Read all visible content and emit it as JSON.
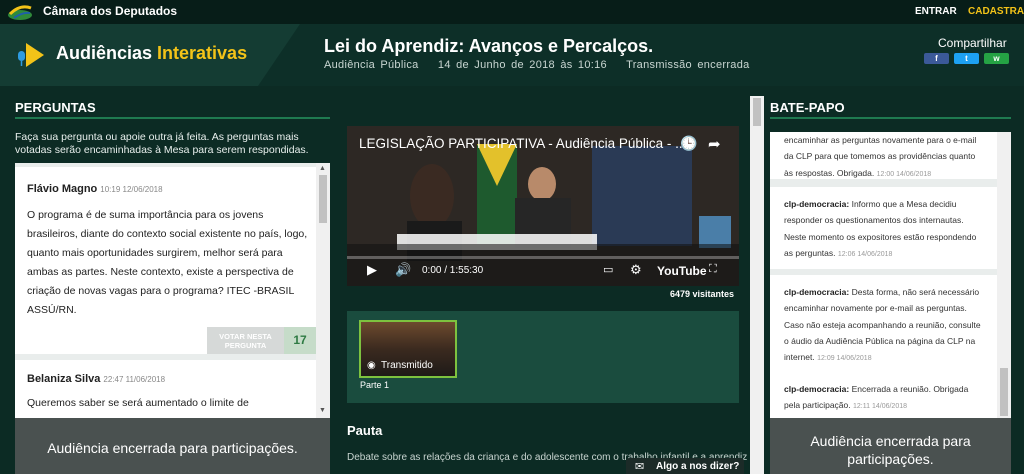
{
  "topbar": {
    "org_name": "Câmara dos Deputados",
    "login": "ENTRAR",
    "register": "CADASTRAR"
  },
  "header": {
    "brand_main": "Audiências ",
    "brand_accent": "Interativas",
    "title": "Lei do Aprendiz: Avanços e Percalços.",
    "type": "Audiência Pública",
    "datetime": "14 de Junho de 2018 às 10:16",
    "status": "Transmissão encerrada",
    "share_label": "Compartilhar",
    "share": {
      "facebook": "f",
      "twitter": "t",
      "whatsapp": "w"
    }
  },
  "perguntas": {
    "heading": "PERGUNTAS",
    "intro": "Faça sua pergunta ou apoie outra já feita. As perguntas mais votadas serão encaminhadas à Mesa para serem respondidas.",
    "questions": [
      {
        "author": "Flávio Magno",
        "time": "10:19 12/06/2018",
        "text": "O programa é de suma importância para os jovens brasileiros, diante do contexto social existente no país, logo, quanto mais oportunidades surgirem, melhor será para ambas as partes. Neste contexto, existe a perspectiva de criação de novas vagas para o programa? ITEC -BRASIL ASSÚ/RN.",
        "vote_label": "VOTAR NESTA PERGUNTA",
        "votes": "17"
      },
      {
        "author": "Belaniza Silva",
        "time": "22:47 11/06/2018",
        "text": "Queremos saber se será aumentado o limite de"
      }
    ],
    "closed": "Audiência encerrada para participações."
  },
  "video": {
    "title": "LEGISLAÇÃO PARTICIPATIVA - Audiência Pública - ...",
    "time": "0:00 / 1:55:30",
    "youtube": "YouTube",
    "visitors": "6479 visitantes"
  },
  "parts": {
    "badge": "Transmitido",
    "label": "Parte 1"
  },
  "pauta": {
    "heading": "Pauta",
    "text": "Debate sobre as relações da criança e do adolescente com o trabalho infantil e a aprendizagem."
  },
  "feedback": {
    "label": "Algo a nos dizer?"
  },
  "chat": {
    "heading": "BATE-PAPO",
    "messages": [
      {
        "user": "",
        "text": "encaminhar as perguntas novamente para o e-mail da CLP para que tomemos as providências quanto às respostas. Obrigada.",
        "time": "12:00 14/06/2018"
      },
      {
        "user": "clp-democracia:",
        "text": "Informo que a Mesa decidiu responder os questionamentos dos internautas. Neste momento os expositores estão respondendo as perguntas.",
        "time": "12:06 14/06/2018"
      },
      {
        "user": "clp-democracia:",
        "text": "Desta forma, não será necessário encaminhar novamente por e-mail as perguntas. Caso não esteja acompanhando a reunião, consulte o áudio da Audiência Pública na página da CLP na internet.",
        "time": "12:09 14/06/2018"
      },
      {
        "user": "clp-democracia:",
        "text": "Encerrada a reunião. Obrigada pela participação.",
        "time": "12:11 14/06/2018"
      }
    ],
    "closed": "Audiência encerrada para participações."
  },
  "colors": {
    "accent": "#f3c318",
    "green": "#1f7a50",
    "background": "#0c2b24"
  }
}
